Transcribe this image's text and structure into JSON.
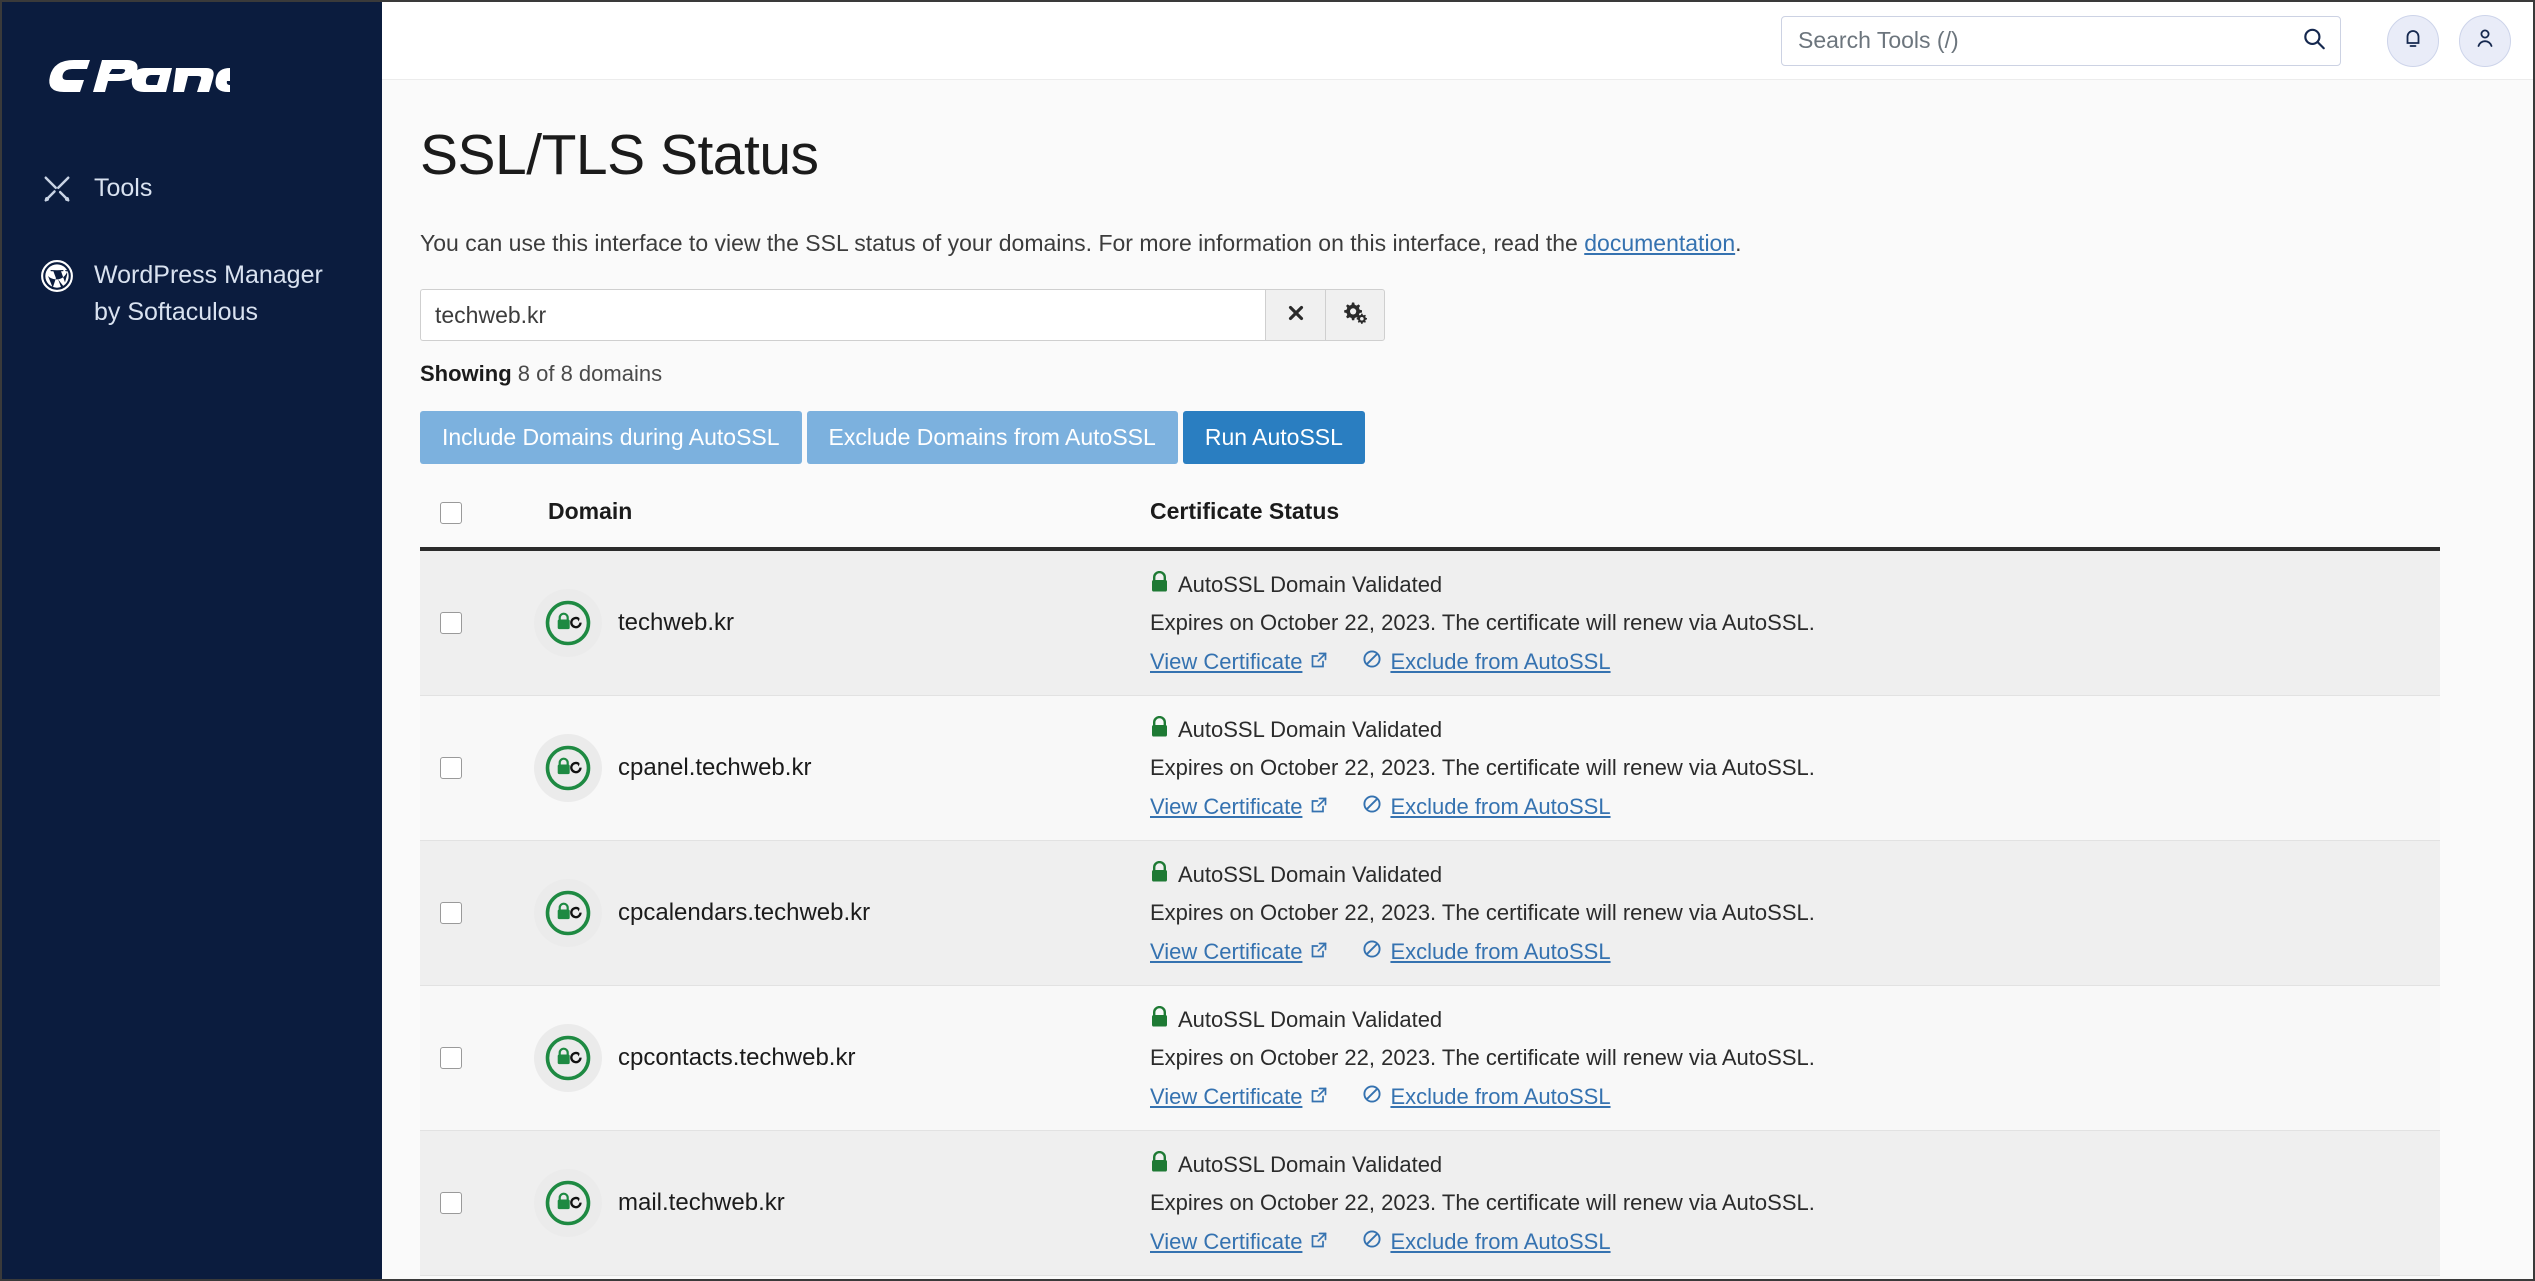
{
  "sidebar": {
    "brand": "cPanel",
    "items": [
      {
        "label": "Tools",
        "icon": "tools-icon"
      },
      {
        "label": "WordPress Manager by Softaculous",
        "icon": "wordpress-icon"
      }
    ]
  },
  "topbar": {
    "search_placeholder": "Search Tools (/)",
    "search_value": "",
    "search_icon": "search-icon",
    "notifications_icon": "bell-icon",
    "account_icon": "user-icon"
  },
  "page": {
    "title": "SSL/TLS Status",
    "description_prefix": "You can use this interface to view the SSL status of your domains. For more information on this interface, read the ",
    "description_link": "documentation",
    "description_suffix": "."
  },
  "filter": {
    "value": "techweb.kr",
    "placeholder": "",
    "clear_icon": "close-icon",
    "settings_icon": "gears-icon"
  },
  "showing": {
    "label": "Showing",
    "text": "8 of 8 domains"
  },
  "actions": {
    "include": "Include Domains during AutoSSL",
    "exclude": "Exclude Domains from AutoSSL",
    "run": "Run AutoSSL",
    "muted_color": "#7cb1de",
    "primary_color": "#2a7ec1"
  },
  "table": {
    "columns": [
      "",
      "Domain",
      "Certificate Status"
    ],
    "rows": [
      {
        "domain": "techweb.kr",
        "icon": "ssl-valid-autossl-icon",
        "status": "AutoSSL Domain Validated",
        "expires": "Expires on October 22, 2023. The certificate will renew via AutoSSL.",
        "view_link": "View Certificate",
        "exclude_link": "Exclude from AutoSSL"
      },
      {
        "domain": "cpanel.techweb.kr",
        "icon": "ssl-valid-autossl-icon",
        "status": "AutoSSL Domain Validated",
        "expires": "Expires on October 22, 2023. The certificate will renew via AutoSSL.",
        "view_link": "View Certificate",
        "exclude_link": "Exclude from AutoSSL"
      },
      {
        "domain": "cpcalendars.techweb.kr",
        "icon": "ssl-valid-autossl-icon",
        "status": "AutoSSL Domain Validated",
        "expires": "Expires on October 22, 2023. The certificate will renew via AutoSSL.",
        "view_link": "View Certificate",
        "exclude_link": "Exclude from AutoSSL"
      },
      {
        "domain": "cpcontacts.techweb.kr",
        "icon": "ssl-valid-autossl-icon",
        "status": "AutoSSL Domain Validated",
        "expires": "Expires on October 22, 2023. The certificate will renew via AutoSSL.",
        "view_link": "View Certificate",
        "exclude_link": "Exclude from AutoSSL"
      },
      {
        "domain": "mail.techweb.kr",
        "icon": "ssl-valid-autossl-icon",
        "status": "AutoSSL Domain Validated",
        "expires": "Expires on October 22, 2023. The certificate will renew via AutoSSL.",
        "view_link": "View Certificate",
        "exclude_link": "Exclude from AutoSSL"
      }
    ]
  },
  "colors": {
    "sidebar_bg": "#0b1c3e",
    "link": "#3572b0",
    "ssl_green": "#1e8a42"
  }
}
